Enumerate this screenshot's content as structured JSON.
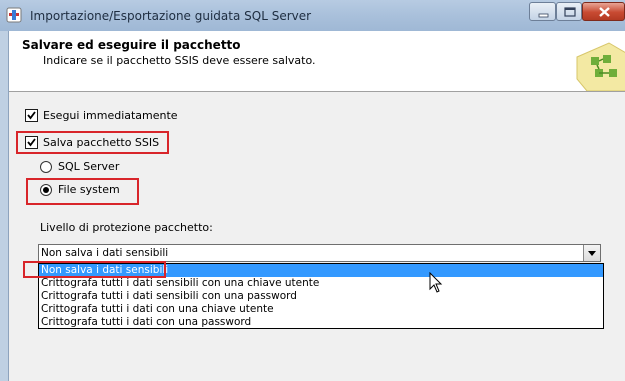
{
  "window": {
    "title": "Importazione/Esportazione guidata SQL Server",
    "controls": [
      "minimize-icon",
      "maximize-icon",
      "close-icon"
    ]
  },
  "header": {
    "title": "Salvare ed eseguire il pacchetto",
    "subtitle": "Indicare se il pacchetto SSIS deve essere salvato."
  },
  "options": {
    "run_now": {
      "label": "Esegui immediatamente",
      "checked": true
    },
    "save_ssis": {
      "label": "Salva pacchetto SSIS",
      "checked": true
    },
    "sql_server": {
      "label": "SQL Server",
      "selected": false
    },
    "file_system": {
      "label": "File system",
      "selected": true
    }
  },
  "protection": {
    "label": "Livello di protezione pacchetto:",
    "value": "Non salva i dati sensibili",
    "list": [
      "Non salva i dati sensibili",
      "Crittografa tutti i dati sensibili con una chiave utente",
      "Crittografa tutti i dati sensibili con una password",
      "Crittografa tutti i dati con una chiave utente",
      "Crittografa tutti i dati con una password"
    ]
  },
  "colors": {
    "highlight_box": "#d8252a",
    "selection": "#3399ff"
  }
}
